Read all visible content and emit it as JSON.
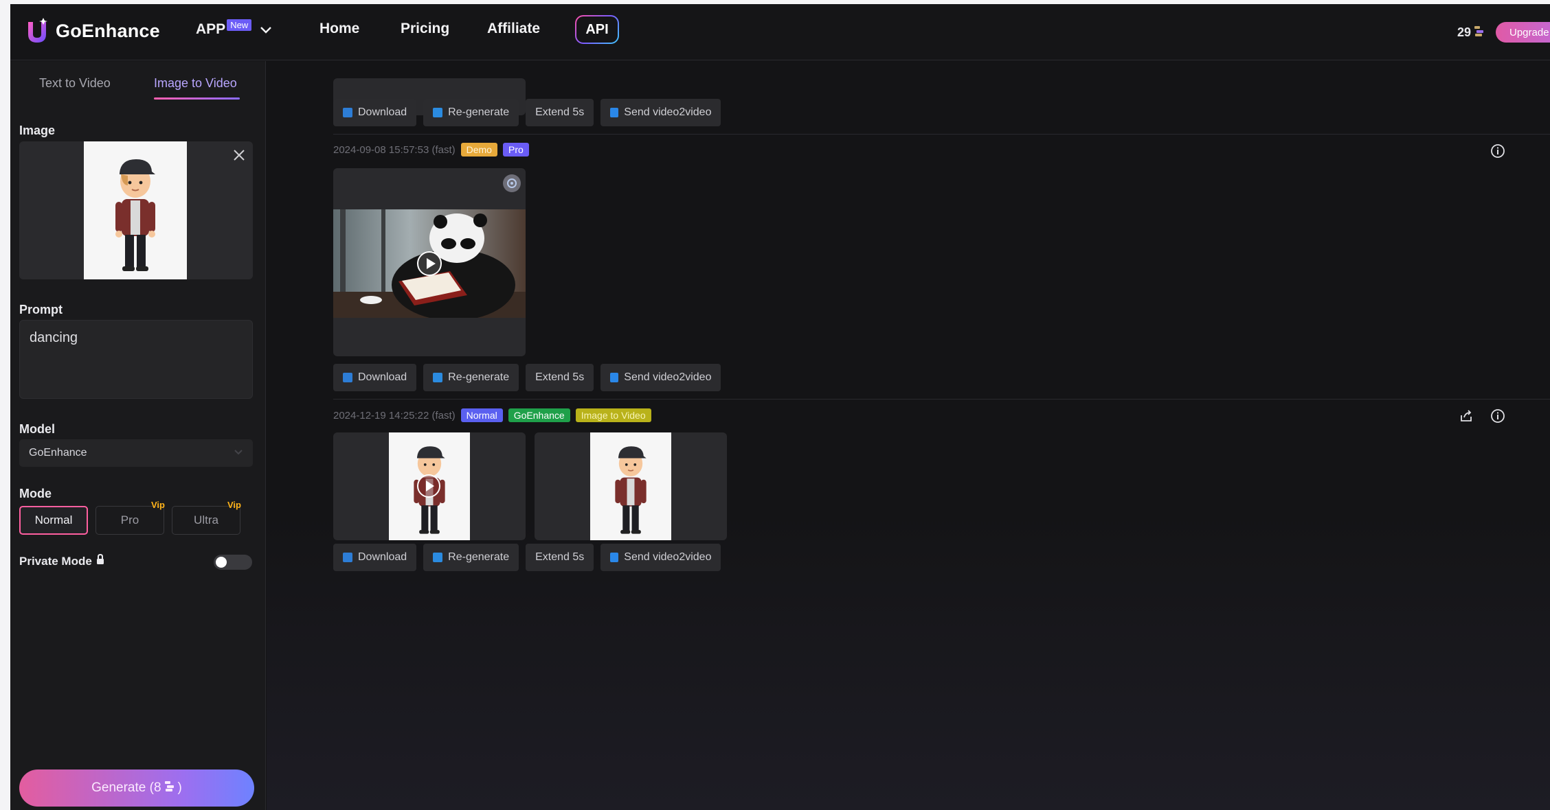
{
  "header": {
    "brand": "GoEnhance",
    "nav": {
      "app": "APP",
      "app_badge": "New",
      "home": "Home",
      "pricing": "Pricing",
      "affiliate": "Affiliate",
      "api": "API"
    },
    "credits": "29",
    "upgrade": "Upgrade"
  },
  "sidebar": {
    "tabs": [
      "Text to Video",
      "Image to Video"
    ],
    "active_tab": "Image to Video",
    "image_label": "Image",
    "prompt_label": "Prompt",
    "prompt_value": "dancing",
    "model_label": "Model",
    "model_value": "GoEnhance",
    "mode_label": "Mode",
    "modes": [
      "Normal",
      "Pro",
      "Ultra"
    ],
    "vip_label": "Vip",
    "selected_mode": "Normal",
    "private_mode_label": "Private Mode",
    "private_mode_on": false,
    "generate_label": "Generate (8",
    "generate_suffix": ")"
  },
  "actions": {
    "download": "Download",
    "regenerate": "Re-generate",
    "extend": "Extend 5s",
    "send": "Send video2video"
  },
  "results": [
    {
      "timestamp": "2024-09-08 15:57:53 (fast)",
      "tags": [
        "Demo",
        "Pro"
      ]
    },
    {
      "timestamp": "2024-12-19 14:25:22 (fast)",
      "tags": [
        "Normal",
        "GoEnhance",
        "Image to Video"
      ]
    }
  ],
  "colors": {
    "accent_pink": "#ff5fa0",
    "accent_purple": "#8a6cff",
    "background": "#141416",
    "vip": "#ffb319"
  }
}
